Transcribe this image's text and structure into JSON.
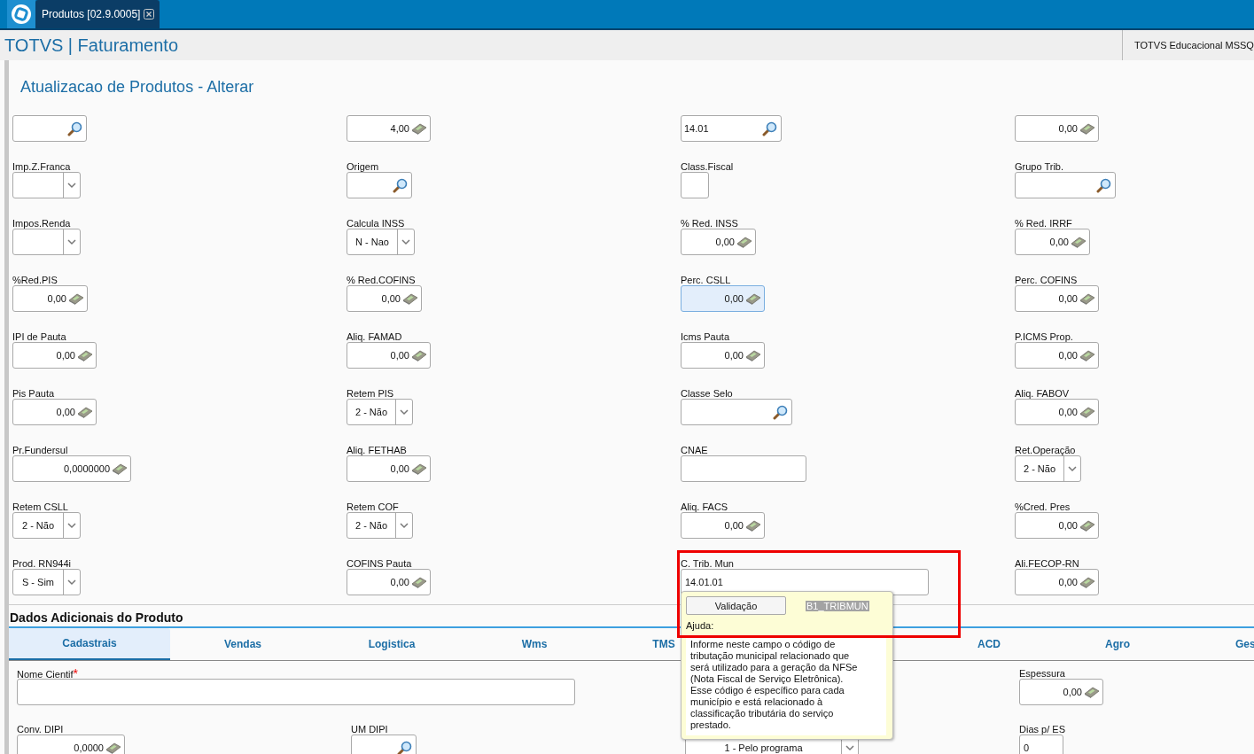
{
  "app_bar": {
    "tab": {
      "label": "Produtos [02.9.0005]",
      "selected": true
    }
  },
  "header": {
    "title": "TOTVS | Faturamento",
    "environment": "TOTVS Educacional MSSQ"
  },
  "form": {
    "title": "Atualizacao de Produtos - Alterar",
    "fields": [
      {
        "kind": "search",
        "focused": false
      },
      {
        "kind": "number",
        "value": "4,00",
        "focused": false
      },
      {
        "kind": "search",
        "value": "14.01",
        "focused": false
      },
      {
        "kind": "number",
        "value": "0,00",
        "focused": false
      },
      {
        "label": "Imp.Z.Franca",
        "kind": "select",
        "focused": false
      },
      {
        "label": "Origem",
        "kind": "search",
        "focused": false
      },
      {
        "label": "Class.Fiscal",
        "kind": "text",
        "focused": false
      },
      {
        "label": "Grupo Trib.",
        "kind": "search",
        "focused": false
      },
      {
        "label": "Impos.Renda",
        "kind": "select",
        "focused": false
      },
      {
        "label": "Calcula INSS",
        "kind": "select",
        "value": "N - Nao",
        "focused": false
      },
      {
        "label": "% Red. INSS",
        "kind": "number",
        "value": "0,00",
        "focused": false
      },
      {
        "label": "% Red. IRRF",
        "kind": "number",
        "value": "0,00",
        "focused": false
      },
      {
        "label": "%Red.PIS",
        "kind": "number",
        "value": "0,00",
        "focused": false
      },
      {
        "label": "% Red.COFINS",
        "kind": "number",
        "value": "0,00",
        "focused": false
      },
      {
        "label": "Perc. CSLL",
        "kind": "number",
        "value": "0,00",
        "focused": true
      },
      {
        "label": "Perc. COFINS",
        "kind": "number",
        "value": "0,00",
        "focused": false
      },
      {
        "label": "IPI de Pauta",
        "kind": "number",
        "value": "0,00",
        "focused": false
      },
      {
        "label": "Aliq. FAMAD",
        "kind": "number",
        "value": "0,00",
        "focused": false
      },
      {
        "label": "Icms Pauta",
        "kind": "number",
        "value": "0,00",
        "focused": false
      },
      {
        "label": "P.ICMS Prop.",
        "kind": "number",
        "value": "0,00",
        "focused": false
      },
      {
        "label": "Pis Pauta",
        "kind": "number",
        "value": "0,00",
        "focused": false
      },
      {
        "label": "Retem PIS",
        "kind": "select",
        "value": "2 - Não",
        "focused": false
      },
      {
        "label": "Classe Selo",
        "kind": "search",
        "focused": false
      },
      {
        "label": "Aliq. FABOV",
        "kind": "number",
        "value": "0,00",
        "focused": false
      },
      {
        "label": "Pr.Fundersul",
        "kind": "number",
        "value": "0,0000000",
        "focused": false
      },
      {
        "label": "Aliq. FETHAB",
        "kind": "number",
        "value": "0,00",
        "focused": false
      },
      {
        "label": "CNAE",
        "kind": "text",
        "focused": false
      },
      {
        "label": "Ret.Operação",
        "kind": "select",
        "value": "2 - Não",
        "focused": false
      },
      {
        "label": "Retem CSLL",
        "kind": "select",
        "value": "2 - Não",
        "focused": false
      },
      {
        "label": "Retem COF",
        "kind": "select",
        "value": "2 - Não",
        "focused": false
      },
      {
        "label": "Aliq. FACS",
        "kind": "number",
        "value": "0,00",
        "focused": false
      },
      {
        "label": "%Cred. Pres",
        "kind": "number",
        "value": "0,00",
        "focused": false
      },
      {
        "label": "Prod. RN944i",
        "kind": "select",
        "value": "S - Sim",
        "focused": false
      },
      {
        "label": "COFINS Pauta",
        "kind": "number",
        "value": "0,00",
        "focused": false
      },
      {
        "label": "C. Trib. Mun",
        "kind": "text",
        "value": "14.01.01",
        "focused": false
      },
      {
        "label": "Ali.FECOP-RN",
        "kind": "number",
        "value": "0,00",
        "focused": false
      }
    ]
  },
  "section": {
    "title": "Dados Adicionais do Produto",
    "tabs": [
      {
        "label": "Cadastrais",
        "selected": true
      },
      {
        "label": "Vendas",
        "selected": false
      },
      {
        "label": "Logistica",
        "selected": false
      },
      {
        "label": "Wms",
        "selected": false
      },
      {
        "label": "TMS",
        "selected": false
      },
      {
        "label": "ACD",
        "selected": false
      },
      {
        "label": "Agro",
        "selected": false
      },
      {
        "label": "Ges",
        "selected": false
      }
    ],
    "fields": [
      {
        "label": "Nome Cientif",
        "required_mark": "*",
        "kind": "text",
        "focused": false
      },
      {
        "label": "Espessura",
        "kind": "number",
        "value": "0,00",
        "focused": false
      },
      {
        "label": "Conv. DIPI",
        "kind": "number",
        "value": "0,0000",
        "focused": false
      },
      {
        "label": "UM DIPI",
        "kind": "search",
        "focused": false
      },
      {
        "kind": "select",
        "value": "1 - Pelo programa",
        "focused": false
      },
      {
        "label": "Dias p/ ES",
        "kind": "text",
        "value": "0",
        "focused": false
      }
    ]
  },
  "tooltip": {
    "framed": true,
    "button": "Validação",
    "field_id": "B1_TRIBMUN",
    "help_label": "Ajuda:",
    "help_text": "Informe neste campo o código de tributação municipal relacionado que será utilizado para a geração da NFSe (Nota Fiscal de Serviço Eletrônica). Esse código é específico para cada município e está relacionado à classificação tributária do serviço prestado."
  }
}
